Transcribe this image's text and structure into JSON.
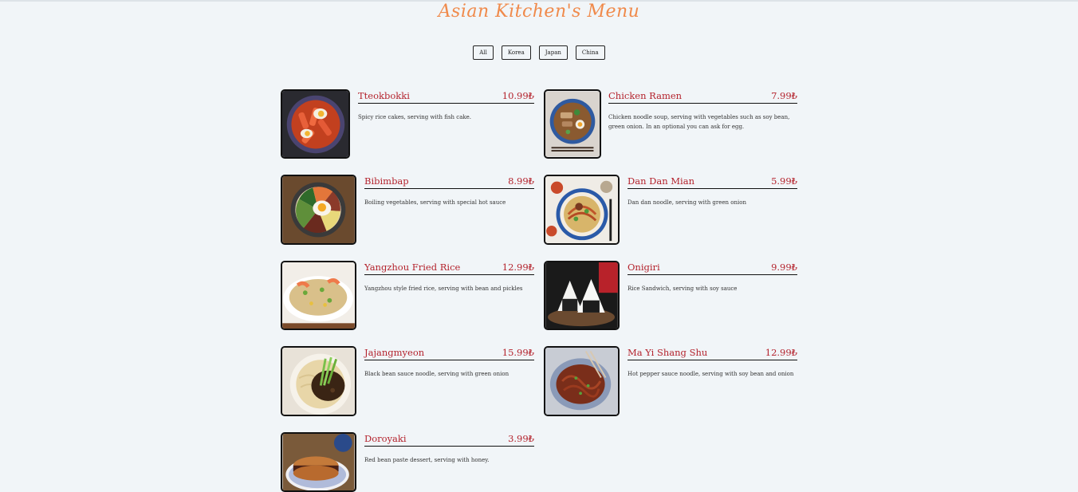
{
  "title": "Asian Kitchen's Menu",
  "filters": [
    "All",
    "Korea",
    "Japan",
    "China"
  ],
  "items": [
    {
      "name": "Tteokbokki",
      "price": "10.99₺",
      "desc": "Spicy rice cakes, serving with fish cake.",
      "icon": "tteokbokki-photo"
    },
    {
      "name": "Chicken Ramen",
      "price": "7.99₺",
      "desc": "Chicken noodle soup, serving with vegetables such as soy bean, green onion. In an optional you can ask for egg.",
      "icon": "chicken-ramen-photo"
    },
    {
      "name": "Bibimbap",
      "price": "8.99₺",
      "desc": "Boiling vegetables, serving with special hot sauce",
      "icon": "bibimbap-photo"
    },
    {
      "name": "Dan Dan Mian",
      "price": "5.99₺",
      "desc": "Dan dan noodle, serving with green onion",
      "icon": "dan-dan-mian-photo"
    },
    {
      "name": "Yangzhou Fried Rice",
      "price": "12.99₺",
      "desc": "Yangzhou style fried rice, serving with bean and pickles",
      "icon": "fried-rice-photo"
    },
    {
      "name": "Onigiri",
      "price": "9.99₺",
      "desc": "Rice Sandwich, serving with soy sauce",
      "icon": "onigiri-photo"
    },
    {
      "name": "Jajangmyeon",
      "price": "15.99₺",
      "desc": "Black bean sauce noodle, serving with green onion",
      "icon": "jajangmyeon-photo"
    },
    {
      "name": "Ma Yi Shang Shu",
      "price": "12.99₺",
      "desc": "Hot pepper sauce noodle, serving with soy bean and onion",
      "icon": "ma-yi-shang-shu-photo"
    },
    {
      "name": "Doroyaki",
      "price": "3.99₺",
      "desc": "Red bean paste dessert, serving with honey.",
      "icon": "doroyaki-photo"
    }
  ]
}
